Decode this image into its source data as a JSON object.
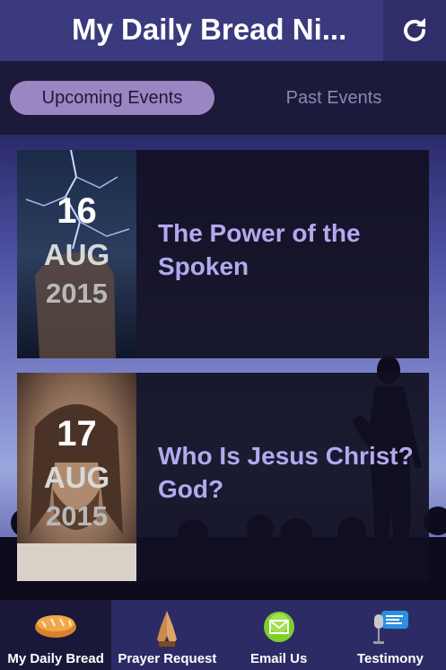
{
  "header": {
    "title": "My Daily Bread Ni..."
  },
  "tabs": [
    {
      "label": "Upcoming Events",
      "active": true
    },
    {
      "label": "Past Events",
      "active": false
    }
  ],
  "events": [
    {
      "day": "16",
      "month": "AUG",
      "year": "2015",
      "title": "The Power of the Spoken",
      "image": "lightning-fist"
    },
    {
      "day": "17",
      "month": "AUG",
      "year": "2015",
      "title": "Who Is Jesus Christ? God?",
      "image": "jesus-portrait"
    }
  ],
  "bottom_nav": [
    {
      "label": "My Daily Bread",
      "icon": "bread-icon",
      "active": true
    },
    {
      "label": "Prayer Request",
      "icon": "praying-hands-icon",
      "active": false
    },
    {
      "label": "Email Us",
      "icon": "email-icon",
      "active": false
    },
    {
      "label": "Testimony",
      "icon": "microphone-icon",
      "active": false
    }
  ],
  "colors": {
    "header": "#3b3a7f",
    "tab_active": "#9a86c2",
    "event_title": "#b3a9ee",
    "bottom_bar": "#2d2b66"
  }
}
